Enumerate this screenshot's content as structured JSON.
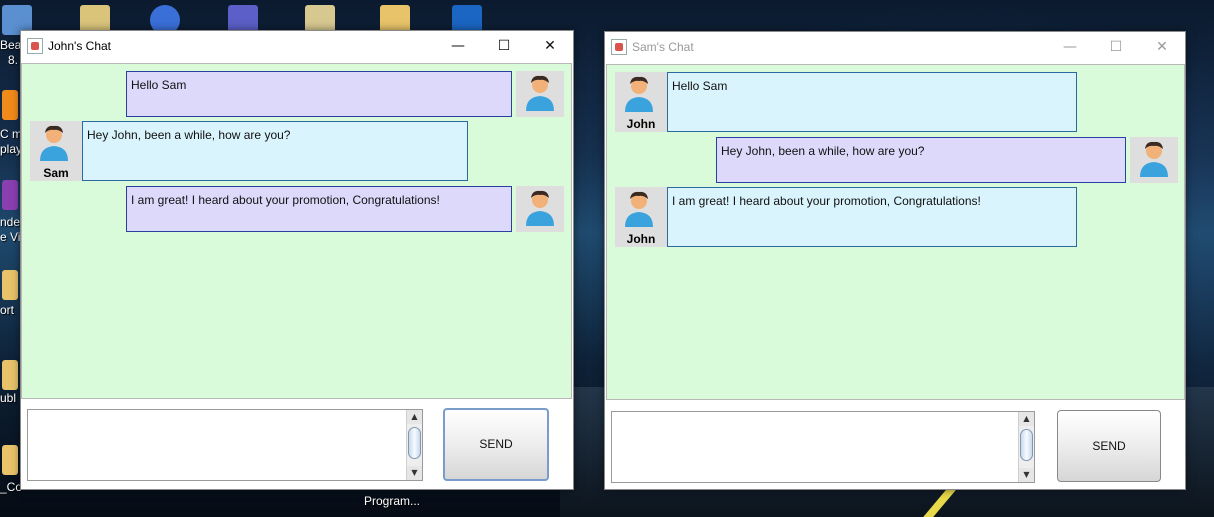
{
  "desktop": {
    "labels": [
      "Bea",
      "8.",
      "C m",
      "play",
      "nde",
      "e Vi",
      "ort",
      "ubl",
      "_Co",
      "Program..."
    ]
  },
  "johns_window": {
    "title": "John's Chat",
    "minimize_symbol": "—",
    "maximize_symbol": "☐",
    "close_symbol": "✕",
    "messages": [
      {
        "text": "Hello Sam",
        "from": "self"
      },
      {
        "text": "Hey John, been a while, how are you?",
        "from": "other",
        "sender": "Sam"
      },
      {
        "text": "I am great! I heard about your promotion, Congratulations!",
        "from": "self"
      }
    ],
    "input_value": "",
    "send_label": "SEND"
  },
  "sams_window": {
    "title": "Sam's Chat",
    "minimize_symbol": "—",
    "maximize_symbol": "☐",
    "close_symbol": "✕",
    "messages": [
      {
        "text": "Hello Sam",
        "from": "other",
        "sender": "John"
      },
      {
        "text": "Hey John, been a while, how are you?",
        "from": "self"
      },
      {
        "text": "I am great! I heard about your promotion, Congratulations!",
        "from": "other",
        "sender": "John"
      }
    ],
    "input_value": "",
    "send_label": "SEND"
  },
  "colors": {
    "chat_background": "#dafbd9",
    "self_bubble": "#dcd9fb",
    "other_bubble": "#d9f4fc"
  },
  "icons": {
    "avatar": "person-avatar-icon",
    "app": "java-app-icon"
  }
}
